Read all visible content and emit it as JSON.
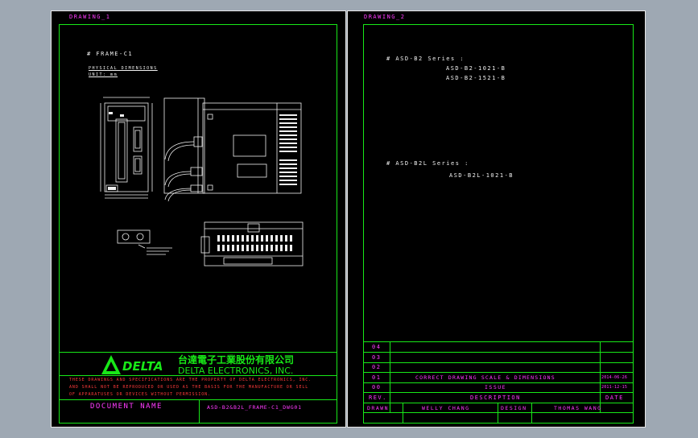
{
  "sheet1": {
    "tab_label": "DRAWING_1",
    "frame_title": "# FRAME-C1",
    "subtitle_1": "PHYSICAL DIMENSIONS",
    "subtitle_2": "UNIT: mm",
    "company_cn": "台達電子工業股份有限公司",
    "company_en": "DELTA ELECTRONICS, INC.",
    "logo_text": "DELTA",
    "notice": [
      "THESE DRAWINGS AND SPECIFICATIONS ARE THE PROPERTY OF DELTA ELECTRONICS, INC.",
      "AND SHALL NOT BE REPRODUCED OR USED AS THE BASIS FOR THE MANUFACTURE OR SELL",
      "OF APPARATUSES OR DEVICES WITHOUT PERMISSION."
    ],
    "document_name_label": "DOCUMENT NAME",
    "document_name_value": "ASD-B2&B2L_FRAME-C1_DWG01"
  },
  "sheet2": {
    "tab_label": "DRAWING_2",
    "series_1_title": "# ASD-B2 Series :",
    "series_1_models": [
      "ASD-B2-1021-B",
      "ASD-B2-1521-B"
    ],
    "series_2_title": "# ASD-B2L Series :",
    "series_2_models": [
      "ASD-B2L-1021-B"
    ],
    "revisions": [
      {
        "rev": "04",
        "description": "",
        "date": ""
      },
      {
        "rev": "03",
        "description": "",
        "date": ""
      },
      {
        "rev": "02",
        "description": "",
        "date": ""
      },
      {
        "rev": "01",
        "description": "CORRECT DRAWING SCALE & DIMENSIONS",
        "date": "2014-06-26"
      },
      {
        "rev": "00",
        "description": "ISSUE",
        "date": "2011-12-15"
      }
    ],
    "rev_header": "REV.",
    "description_header": "DESCRIPTION",
    "date_header": "DATE",
    "drawn_label": "DRAWN",
    "drawn_value": "WELLY CHANG",
    "design_label": "DESIGN",
    "design_value": "THOMAS WANG"
  },
  "colors": {
    "background": "#9ea8b3",
    "sheet": "#000000",
    "frame_line": "#18e818",
    "label_text": "#ff3cff",
    "drawing_line": "#f0f0f0",
    "warning_text": "#ff3a3a"
  }
}
